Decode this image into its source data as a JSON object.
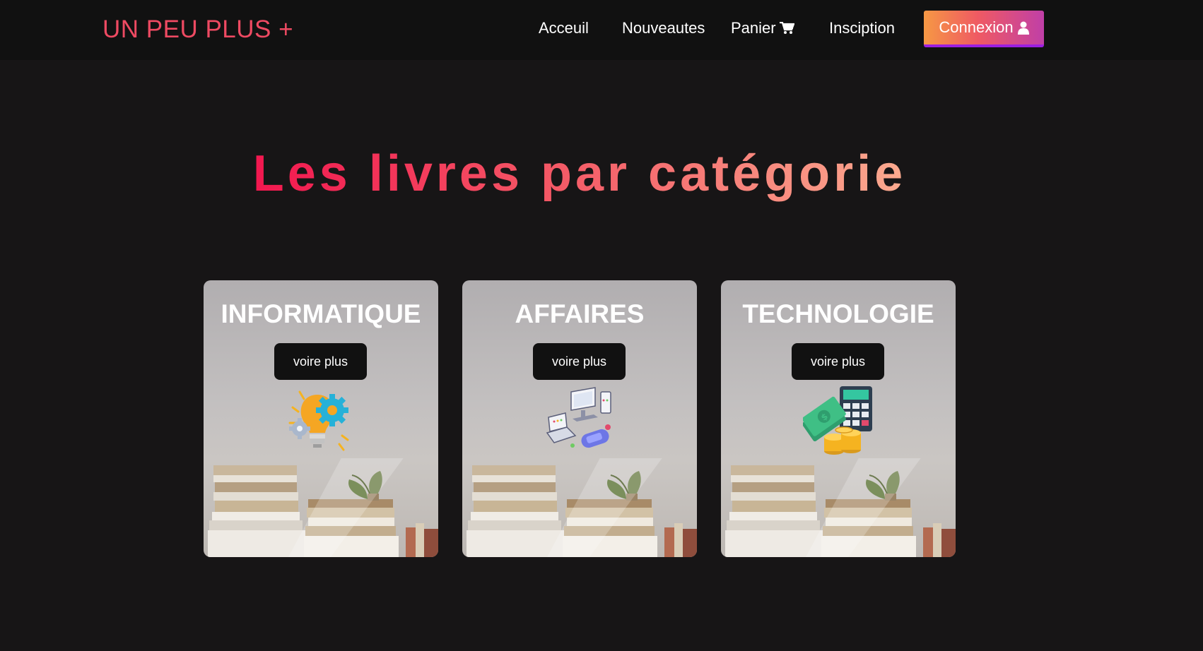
{
  "brand": "UN PEU PLUS +",
  "nav": {
    "home": "Acceuil",
    "new": "Nouveautes",
    "cart": "Panier",
    "signup": "Insciption",
    "login": "Connexion"
  },
  "heading": "Les livres par catégorie",
  "categories": [
    {
      "title": "INFORMATIQUE",
      "button": "voire plus",
      "icon": "lightbulb-gears-icon"
    },
    {
      "title": "AFFAIRES",
      "button": "voire plus",
      "icon": "devices-icon"
    },
    {
      "title": "TECHNOLOGIE",
      "button": "voire plus",
      "icon": "money-calculator-icon"
    }
  ],
  "colors": {
    "brand": "#ee4a62",
    "background": "#171516",
    "navbar": "#111111",
    "title_gradient": [
      "#f2174f",
      "#fbaa8f"
    ],
    "login_gradient": [
      "#f69844",
      "#c03fa7"
    ]
  }
}
